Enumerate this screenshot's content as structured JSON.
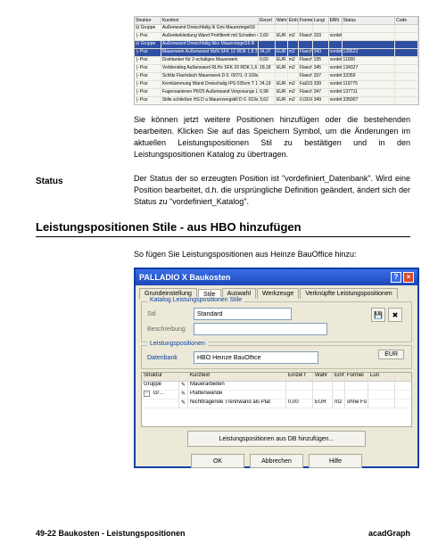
{
  "topTable": {
    "headers": [
      "Struktur",
      "Kurztext",
      "Einzel",
      "Wahr",
      "Einh",
      "Formel",
      "Lungi",
      "EBN",
      "Status",
      "Code"
    ],
    "rows": [
      {
        "sel": false,
        "cells": [
          "⊟ Gruppe",
          "Außenwand Dreischfalig Ik Gris Mauerziegel16",
          "",
          "",
          "",
          "",
          "",
          "",
          "",
          ""
        ]
      },
      {
        "sel": false,
        "cells": [
          "├ Pos",
          "Außenbekleidung Wand Profilbrett mit Schatten mit 2",
          "2,60",
          "EUR",
          "m2",
          "Flaeche",
          "333",
          "vordefiniert_Datenbank",
          "",
          ""
        ]
      },
      {
        "sel": true,
        "cells": [
          "⊟ Gruppe",
          "Außenwand Dreischfalig Ikkz Mauerziegel16 B",
          "",
          "",
          "",
          "",
          "",
          "",
          "",
          ""
        ]
      },
      {
        "sel": true,
        "cells": [
          "├ Pos",
          "Mauerwerk Außenwand MzN SFK 12 RDK 1,8 37",
          "34,37",
          "EUR",
          "m2",
          "Flaeche",
          "343",
          "vordefiniert_Datenbank",
          "128622",
          ""
        ]
      },
      {
        "sel": false,
        "cells": [
          "├ Pos",
          "Drahtanker für 2-schaliges Mauerwerk",
          "0,60",
          "EUR",
          "m2",
          "Flaeche",
          "335",
          "vordefiniert_Datenbank",
          "11000",
          ""
        ]
      },
      {
        "sel": false,
        "cells": [
          "├ Pos",
          "Vorblending Außenwand RLHz SFK 20 RDK 1,6 11,5c",
          "18,18",
          "EUR",
          "m2",
          "Flaeche",
          "345",
          "vordefiniert_Datenbank",
          "134327",
          ""
        ]
      },
      {
        "sel": false,
        "cells": [
          "├ Pos",
          "Schlitz Flachdach Mauerwerk D 0. 007/1. 0 109s",
          "",
          "",
          "",
          "Flaeche",
          "337",
          "vordefiniert_Datenbank",
          "33359",
          ""
        ]
      },
      {
        "sel": false,
        "cells": [
          "├ Pos",
          "Kernkämmung Wand Dreischalig IPS 035cm T 19s",
          "24,19",
          "EUR",
          "m2",
          "Fat2/3",
          "339",
          "vordefiniert_Datenbank",
          "119775",
          ""
        ]
      },
      {
        "sel": false,
        "cells": [
          "├ Pos",
          "Fugensanieren PII/25 Außenwand Verposungs LXGrAlt",
          "6,98",
          "EUR",
          "m2",
          "Flaeche",
          "347",
          "vordefiniert_Datenbank",
          "137711",
          ""
        ]
      },
      {
        "sel": false,
        "cells": [
          "├ Pos",
          "Stille schließen HS D a Mauerzengstill D 0. 019s T 12c",
          "3,62",
          "EUR",
          "m2",
          "0.031Flac",
          "349",
          "vordefiniert_Datenbank",
          "335007",
          ""
        ]
      }
    ]
  },
  "para1": "Sie können jetzt weitere Positionen hinzufügen oder die bestehenden bearbeiten. Klicken Sie auf das Speichern Symbol, um die Änderungen im aktuellen Leistungspositionen Stil zu bestätigen und in den Leistungspositionen Katalog zu übertragen.",
  "statusLabel": "Status",
  "para2": "Der Status der so erzeugten Position ist \"vordefiniert_Datenbank\". Wird eine Position bearbeitet, d.h. die ursprüngliche Definition geändert, ändert sich der Status zu \"vordefiniert_Katalog\".",
  "sectionHead": "Leistungspositionen Stile - aus HBO hinzufügen",
  "intro": "So fügen Sie Leistungspositionen aus Heinze BauOffice hinzu:",
  "dialog": {
    "title": "PALLADIO X  Baukosten",
    "tabs": [
      "Grundeinstellung",
      "Stile",
      "Auswahl",
      "Werkzeuge",
      "Verknüpfte Leistungspositionen"
    ],
    "activeTab": 1,
    "group1": {
      "legend": "Katalog Leistungspositionen Stile",
      "stilLabel": "Stil",
      "stilValue": "Standard",
      "descLabel": "Beschreibung",
      "descValue": ""
    },
    "group2": {
      "legend": "Leistungspositionen",
      "dbLabel": "Datenbank",
      "dbValue": "HBO Heinze BauOffice",
      "eur": "EUR"
    },
    "minitable": {
      "headers": [
        "Struktur",
        "",
        "Kurztext",
        "Einzel f",
        "Wahr",
        "Einh",
        "Formel",
        "Lun"
      ],
      "rows": [
        {
          "cells": [
            "Gruppe",
            "✎",
            "Mauerarbeiten",
            "",
            "",
            "",
            "",
            ""
          ]
        },
        {
          "cells": [
            "⊟ Gr…",
            "✎",
            "Plattenwände",
            "",
            "",
            "",
            "",
            ""
          ]
        },
        {
          "cells": [
            "",
            "✎",
            "Nichttragende Trennwand als Plat",
            "0,00",
            "EUR",
            "m2",
            "ohne Fo",
            ""
          ]
        }
      ]
    },
    "longBtn": "Leistungspositionen aus DB hinzufügen...",
    "buttons": {
      "ok": "OK",
      "cancel": "Abbrechen",
      "help": "Hilfe"
    }
  },
  "footer": {
    "left": "49-22 Baukosten - Leistungspositionen",
    "right": "acadGraph"
  }
}
